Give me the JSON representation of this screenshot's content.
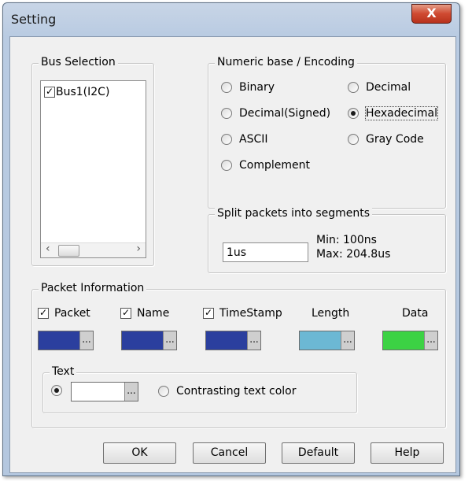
{
  "window": {
    "title": "Setting",
    "close_glyph": "X"
  },
  "bus_selection": {
    "legend": "Bus Selection",
    "items": [
      {
        "label": "Bus1(I2C)",
        "checked": true
      }
    ],
    "scroll_left": "‹",
    "scroll_right": "›"
  },
  "encoding": {
    "legend": "Numeric base / Encoding",
    "options": [
      {
        "label": "Binary",
        "selected": false
      },
      {
        "label": "Decimal",
        "selected": false
      },
      {
        "label": "Decimal(Signed)",
        "selected": false
      },
      {
        "label": "Hexadecimal",
        "selected": true
      },
      {
        "label": "ASCII",
        "selected": false
      },
      {
        "label": "Gray Code",
        "selected": false
      },
      {
        "label": "Complement",
        "selected": false
      }
    ]
  },
  "split": {
    "legend": "Split packets into segments",
    "value": "1us",
    "min_label": "Min: 100ns",
    "max_label": "Max: 204.8us"
  },
  "packet_info": {
    "legend": "Packet Information",
    "columns": [
      {
        "label": "Packet",
        "has_checkbox": true,
        "checked": true,
        "color": "#2b3f9e"
      },
      {
        "label": "Name",
        "has_checkbox": true,
        "checked": true,
        "color": "#2b3f9e"
      },
      {
        "label": "TimeStamp",
        "has_checkbox": true,
        "checked": true,
        "color": "#2b3f9e"
      },
      {
        "label": "Length",
        "has_checkbox": false,
        "color": "#6cb8d4"
      },
      {
        "label": "Data",
        "has_checkbox": false,
        "color": "#3cd244"
      }
    ],
    "dots": "...",
    "text_group": {
      "legend": "Text",
      "custom_selected": true,
      "custom_color": "#ffffff",
      "contrasting_label": "Contrasting text color",
      "contrasting_selected": false
    }
  },
  "buttons": {
    "ok": "OK",
    "cancel": "Cancel",
    "default": "Default",
    "help": "Help"
  }
}
